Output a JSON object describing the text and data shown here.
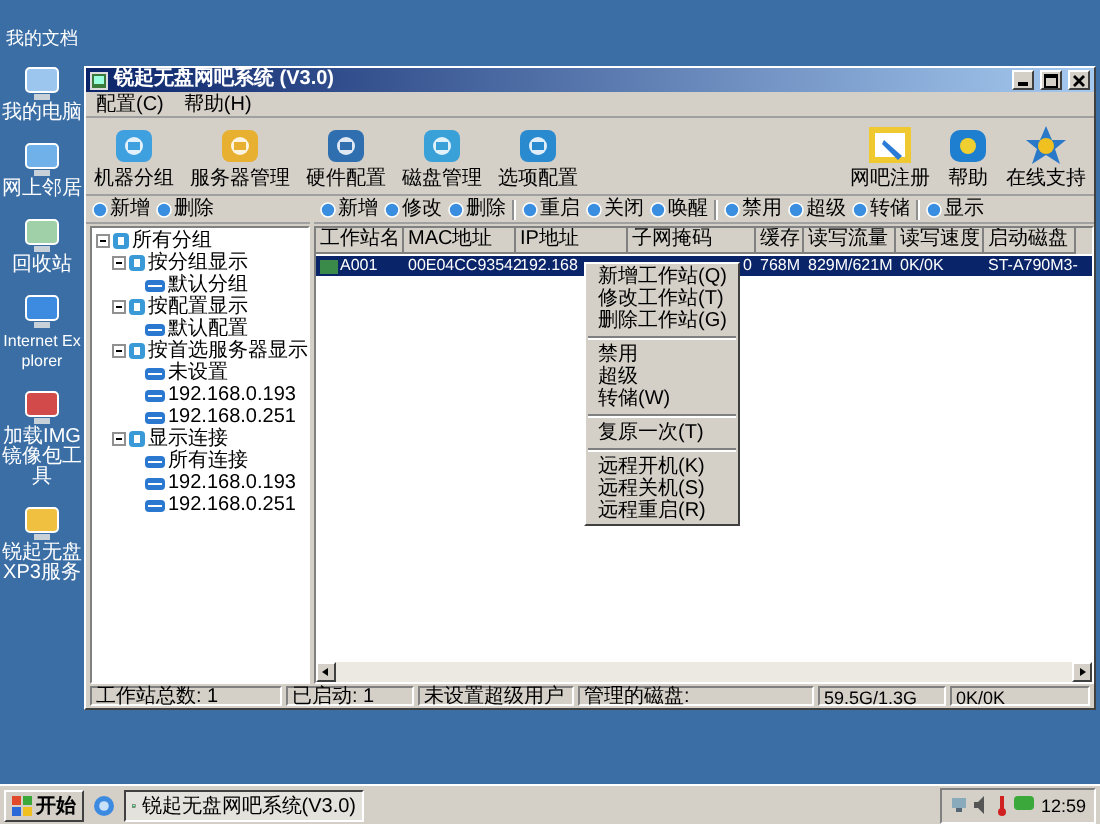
{
  "desktop_icons": [
    {
      "label": "我的文档"
    },
    {
      "label": "我的电脑"
    },
    {
      "label": "网上邻居"
    },
    {
      "label": "回收站"
    },
    {
      "label": "Internet Explorer"
    },
    {
      "label": "加载IMG镜像包工具"
    },
    {
      "label": "锐起无盘XP3服务"
    }
  ],
  "window": {
    "title": "锐起无盘网吧系统 (V3.0)"
  },
  "menu": [
    "配置(C)",
    "帮助(H)"
  ],
  "toolbar": {
    "left": [
      "机器分组",
      "服务器管理",
      "硬件配置",
      "磁盘管理",
      "选项配置"
    ],
    "right": [
      "网吧注册",
      "帮助",
      "在线支持"
    ]
  },
  "left_pane": {
    "buttons": [
      "新增",
      "删除"
    ],
    "tree": [
      {
        "label": "所有分组",
        "expanded": true,
        "children": [
          {
            "label": "按分组显示",
            "expanded": true,
            "children": [
              {
                "label": "默认分组"
              }
            ]
          },
          {
            "label": "按配置显示",
            "expanded": true,
            "children": [
              {
                "label": "默认配置"
              }
            ]
          },
          {
            "label": "按首选服务器显示",
            "expanded": true,
            "children": [
              {
                "label": "未设置"
              },
              {
                "label": "192.168.0.193"
              },
              {
                "label": "192.168.0.251"
              }
            ]
          },
          {
            "label": "显示连接",
            "expanded": true,
            "children": [
              {
                "label": "所有连接"
              },
              {
                "label": "192.168.0.193"
              },
              {
                "label": "192.168.0.251"
              }
            ]
          }
        ]
      }
    ]
  },
  "right_pane": {
    "button_groups": [
      [
        "新增",
        "修改",
        "删除"
      ],
      [
        "重启",
        "关闭",
        "唤醒"
      ],
      [
        "禁用",
        "超级",
        "转储"
      ],
      [
        "显示"
      ]
    ],
    "table": {
      "columns": [
        "工作站名",
        "MAC地址",
        "IP地址",
        "子网掩码",
        "缓存",
        "读写流量",
        "读写速度",
        "启动磁盘"
      ],
      "rows": [
        {
          "selected": true,
          "cells": [
            "A001",
            "00E04CC93542",
            "192.168",
            "0",
            "768M",
            "829M/621M",
            "0K/0K",
            "ST-A790M3-"
          ]
        }
      ]
    }
  },
  "context_menu": [
    [
      "新增工作站(Q)",
      "修改工作站(T)",
      "删除工作站(G)"
    ],
    [
      "禁用",
      "超级",
      "转储(W)"
    ],
    [
      "复原一次(T)"
    ],
    [
      "远程开机(K)",
      "远程关机(S)",
      "远程重启(R)"
    ]
  ],
  "status_bar": [
    "工作站总数: 1",
    "已启动: 1",
    "未设置超级用户",
    "管理的磁盘:",
    "59.5G/1.3G",
    "0K/0K"
  ],
  "taskbar": {
    "start": "开始",
    "tasks": [
      "锐起无盘网吧系统(V3.0)"
    ],
    "clock": "12:59"
  }
}
